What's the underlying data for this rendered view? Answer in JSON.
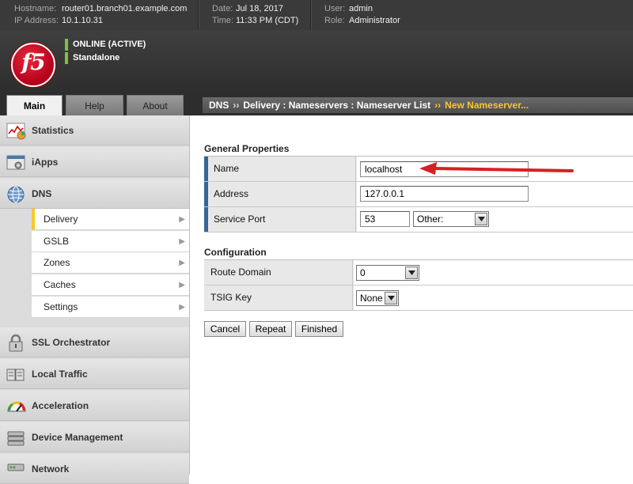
{
  "topbar": {
    "hostname_label": "Hostname:",
    "hostname": "router01.branch01.example.com",
    "ip_label": "IP Address:",
    "ip": "10.1.10.31",
    "date_label": "Date:",
    "date": "Jul 18, 2017",
    "time_label": "Time:",
    "time": "11:33 PM (CDT)",
    "user_label": "User:",
    "user": "admin",
    "role_label": "Role:",
    "role": "Administrator"
  },
  "header": {
    "logo_text": "f5",
    "status_primary": "ONLINE (ACTIVE)",
    "status_secondary": "Standalone",
    "status_color": "#7dc242"
  },
  "tabs": [
    {
      "label": "Main",
      "active": true
    },
    {
      "label": "Help",
      "active": false
    },
    {
      "label": "About",
      "active": false
    }
  ],
  "breadcrumb": {
    "parts": [
      "DNS",
      "Delivery : Nameservers : Nameserver List"
    ],
    "separator": "››",
    "current": "New Nameserver..."
  },
  "sidebar": {
    "sections_top": [
      {
        "label": "Statistics",
        "icon": "statistics-icon"
      },
      {
        "label": "iApps",
        "icon": "iapps-icon"
      },
      {
        "label": "DNS",
        "icon": "dns-globe-icon"
      }
    ],
    "dns_sub": [
      {
        "label": "Delivery",
        "active": true
      },
      {
        "label": "GSLB",
        "active": false
      },
      {
        "label": "Zones",
        "active": false
      },
      {
        "label": "Caches",
        "active": false
      },
      {
        "label": "Settings",
        "active": false
      }
    ],
    "sections_bottom": [
      {
        "label": "SSL Orchestrator",
        "icon": "lock-icon"
      },
      {
        "label": "Local Traffic",
        "icon": "local-traffic-icon"
      },
      {
        "label": "Acceleration",
        "icon": "gauge-icon"
      },
      {
        "label": "Device Management",
        "icon": "device-icon"
      },
      {
        "label": "Network",
        "icon": "network-icon"
      }
    ]
  },
  "general": {
    "title": "General Properties",
    "name_label": "Name",
    "name_value": "localhost",
    "address_label": "Address",
    "address_value": "127.0.0.1",
    "port_label": "Service Port",
    "port_value": "53",
    "port_select": "Other:"
  },
  "configuration": {
    "title": "Configuration",
    "route_domain_label": "Route Domain",
    "route_domain_value": "0",
    "tsig_label": "TSIG Key",
    "tsig_value": "None"
  },
  "buttons": {
    "cancel": "Cancel",
    "repeat": "Repeat",
    "finished": "Finished"
  },
  "colors": {
    "accent_yellow": "#f6c928",
    "required_bar": "#35669a",
    "annotation_arrow": "#d81f26"
  }
}
